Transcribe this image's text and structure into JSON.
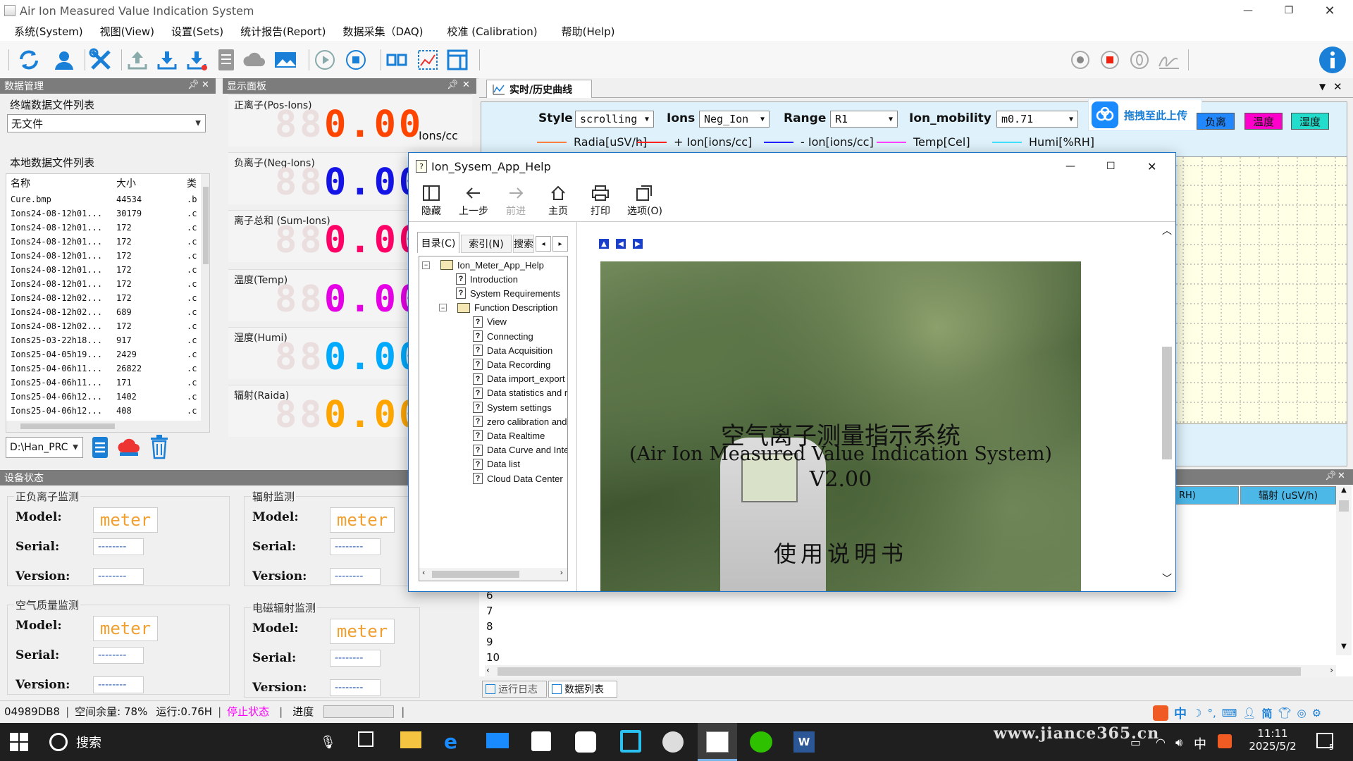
{
  "window": {
    "title": "Air Ion Measured Value Indication System"
  },
  "menu": [
    "系统(System)",
    "视图(View)",
    "设置(Sets)",
    "统计报告(Report)",
    "数据采集（DAQ)",
    "校准 (Calibration)",
    "帮助(Help)"
  ],
  "data_mgmt": {
    "title": "数据管理",
    "terminal_label": "终端数据文件列表",
    "terminal_value": "无文件",
    "local_label": "本地数据文件列表",
    "columns": [
      "名称",
      "大小",
      "类"
    ],
    "files": [
      [
        "Cure.bmp",
        "44534",
        ".b"
      ],
      [
        "Ions24-08-12h01...",
        "30179",
        ".c"
      ],
      [
        "Ions24-08-12h01...",
        "172",
        ".c"
      ],
      [
        "Ions24-08-12h01...",
        "172",
        ".c"
      ],
      [
        "Ions24-08-12h01...",
        "172",
        ".c"
      ],
      [
        "Ions24-08-12h01...",
        "172",
        ".c"
      ],
      [
        "Ions24-08-12h01...",
        "172",
        ".c"
      ],
      [
        "Ions24-08-12h02...",
        "172",
        ".c"
      ],
      [
        "Ions24-08-12h02...",
        "689",
        ".c"
      ],
      [
        "Ions24-08-12h02...",
        "172",
        ".c"
      ],
      [
        "Ions25-03-22h18...",
        "917",
        ".c"
      ],
      [
        "Ions25-04-05h19...",
        "2429",
        ".c"
      ],
      [
        "Ions25-04-06h11...",
        "26822",
        ".c"
      ],
      [
        "Ions25-04-06h11...",
        "171",
        ".c"
      ],
      [
        "Ions25-04-06h12...",
        "1402",
        ".c"
      ],
      [
        "Ions25-04-06h12...",
        "408",
        ".c"
      ]
    ],
    "path": "D:\\Han_PRC"
  },
  "display": {
    "title": "显示面板",
    "rows": [
      {
        "label": "正离子(Pos-Ions)",
        "value": "0.00",
        "color": "#ff4400",
        "unit": "Ions/cc"
      },
      {
        "label": "负离子(Neg-Ions)",
        "value": "0.00",
        "color": "#1414e6",
        "unit": ""
      },
      {
        "label": "离子总和 (Sum-Ions)",
        "value": "0.00",
        "color": "#ff0066",
        "unit": ""
      },
      {
        "label": "温度(Temp)",
        "value": "0.00",
        "color": "#e600e6",
        "unit": ""
      },
      {
        "label": "湿度(Humi)",
        "value": "0.00",
        "color": "#00aaff",
        "unit": ""
      },
      {
        "label": "辐射(Raida)",
        "value": "0.00",
        "color": "#ffa500",
        "unit": ""
      }
    ]
  },
  "curve": {
    "tab": "实时/历史曲线",
    "style_label": "Style",
    "style_value": "scrolling",
    "ions_label": "Ions",
    "ions_value": "Neg_Ion",
    "range_label": "Range",
    "range_value": "R1",
    "mobility_label": "Ion_mobility",
    "mobility_value": "m0.71",
    "upload": "拖拽至此上传",
    "badges": [
      {
        "text": "负离",
        "color": "#2288ff"
      },
      {
        "text": "温度",
        "color": "#ff00cc"
      },
      {
        "text": "湿度",
        "color": "#22ddcc"
      }
    ],
    "legend": [
      {
        "text": "Radia[uSV/h]",
        "color": "#ff8040"
      },
      {
        "text": "+ Ion[ions/cc]",
        "color": "#ff2020"
      },
      {
        "text": "- Ion[ions/cc]",
        "color": "#2020ff"
      },
      {
        "text": "Temp[Cel]",
        "color": "#ff40ff"
      },
      {
        "text": "Humi[%RH]",
        "color": "#40e0ff"
      }
    ]
  },
  "table": {
    "col_partial": "RH)",
    "col_rad": "辐射 (uSV/h)",
    "row_numbers": [
      "6",
      "7",
      "8",
      "9",
      "10"
    ],
    "tabs": [
      "运行日志",
      "数据列表"
    ]
  },
  "device": {
    "title": "设备状态",
    "groups": [
      {
        "name": "正负离子监测",
        "model": "meter",
        "serial": "--------",
        "version": "--------"
      },
      {
        "name": "辐射监测",
        "model": "meter",
        "serial": "--------",
        "version": "--------"
      },
      {
        "name": "空气质量监测",
        "model": "meter",
        "serial": "--------",
        "version": "--------"
      },
      {
        "name": "电磁辐射监测",
        "model": "meter",
        "serial": "--------",
        "version": "--------"
      }
    ],
    "model_label": "Model:",
    "serial_label": "Serial:",
    "version_label": "Version:"
  },
  "help": {
    "title": "Ion_Sysem_App_Help",
    "toolbar": [
      "隐藏",
      "上一步",
      "前进",
      "主页",
      "打印",
      "选项(O)"
    ],
    "tabs": [
      "目录(C)",
      "索引(N)",
      "搜索"
    ],
    "toc_root": "Ion_Meter_App_Help",
    "toc_items": [
      "Introduction",
      "System Requirements"
    ],
    "toc_group": "Function Description",
    "toc_sub": [
      "View",
      "Connecting",
      "Data Acquisition",
      "Data Recording",
      "Data import_export a",
      "Data statistics and r",
      "System settings",
      "zero calibration and",
      "Data Realtime",
      "Data Curve and Inter",
      "Data list",
      "Cloud Data Center"
    ],
    "doc_title_cn": "空气离子测量指示系统",
    "doc_title_en": "(Air Ion Measured Value Indication System)",
    "doc_version": "V2.00",
    "doc_manual": "使用说明书"
  },
  "status": {
    "id": "04989DB8",
    "space": "空间余量: 78%",
    "runtime": "运行:0.76H",
    "state": "停止状态",
    "progress_label": "进度",
    "progress": 0,
    "state_color": "#ff00ff"
  },
  "taskbar": {
    "search": "搜索",
    "time": "11:11",
    "date": "2025/5/2",
    "ime": "中",
    "watermark": "www.jiance365.cn",
    "notify_count": "5"
  }
}
